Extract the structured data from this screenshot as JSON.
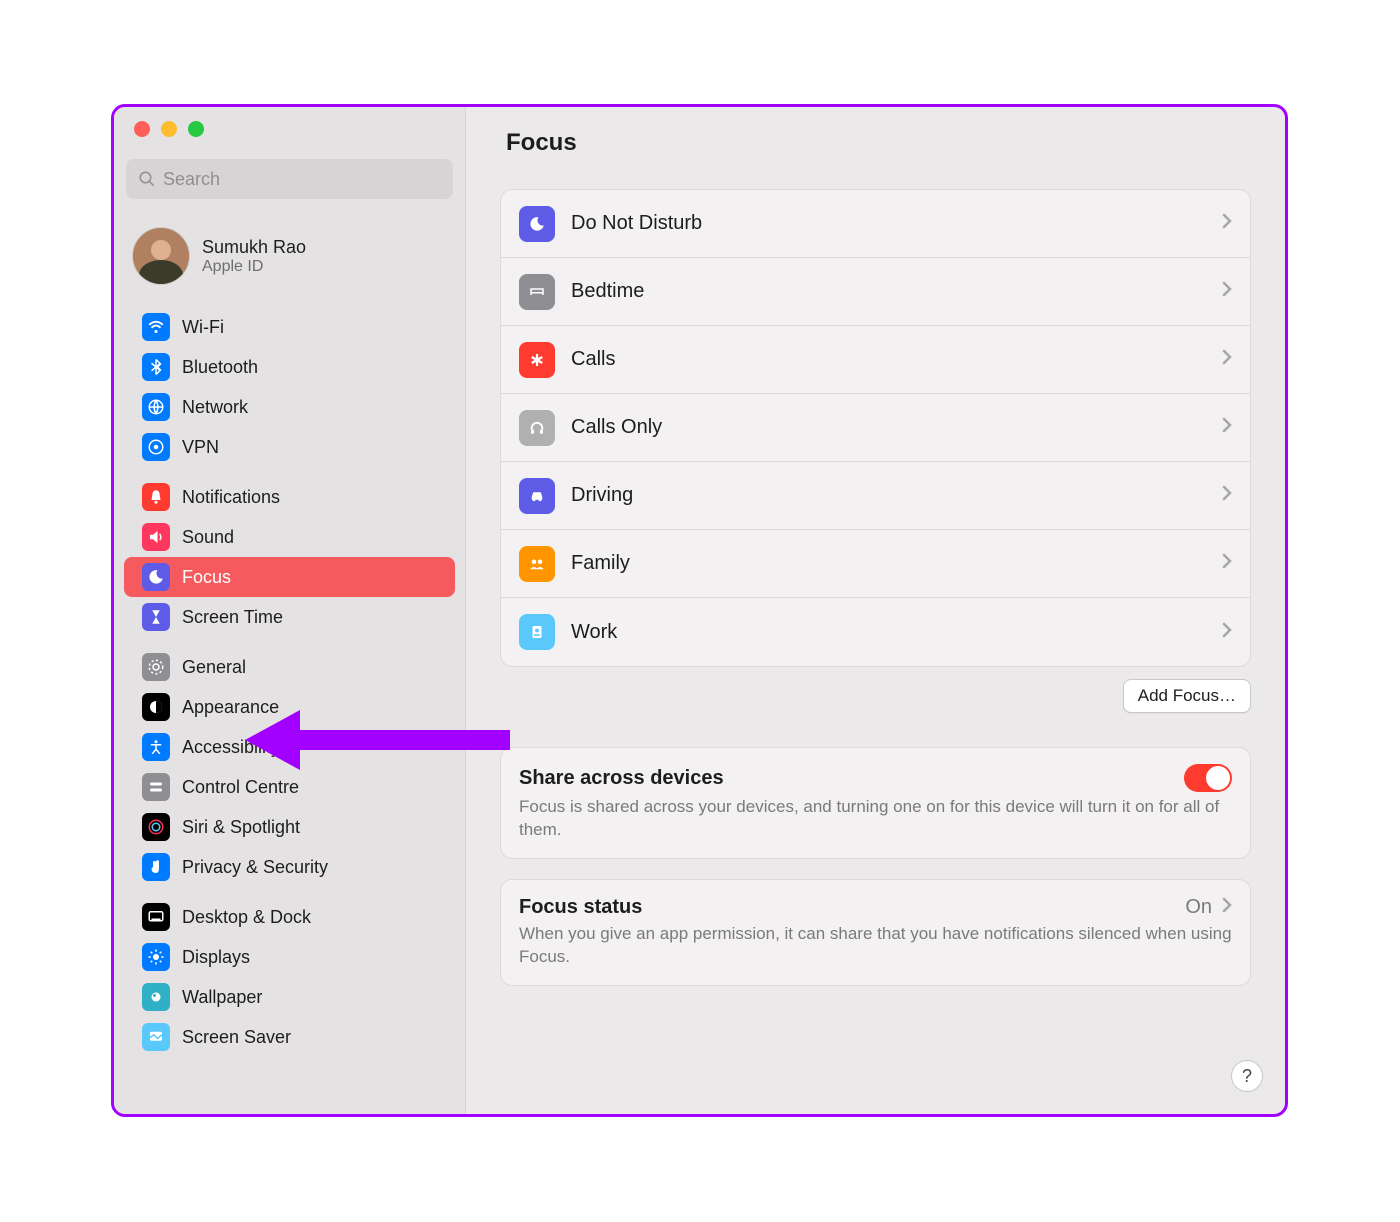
{
  "search": {
    "placeholder": "Search"
  },
  "user": {
    "name": "Sumukh Rao",
    "sub": "Apple ID"
  },
  "sidebar": {
    "g1": [
      {
        "label": "Wi-Fi",
        "icon": "wifi",
        "color": "blue"
      },
      {
        "label": "Bluetooth",
        "icon": "bluetooth",
        "color": "blue"
      },
      {
        "label": "Network",
        "icon": "network",
        "color": "blue"
      },
      {
        "label": "VPN",
        "icon": "vpn",
        "color": "blue"
      }
    ],
    "g2": [
      {
        "label": "Notifications",
        "icon": "bell",
        "color": "red"
      },
      {
        "label": "Sound",
        "icon": "sound",
        "color": "pink"
      },
      {
        "label": "Focus",
        "icon": "moon",
        "color": "indigo",
        "active": true
      },
      {
        "label": "Screen Time",
        "icon": "hourglass",
        "color": "indigo"
      }
    ],
    "g3": [
      {
        "label": "General",
        "icon": "gear",
        "color": "gray"
      },
      {
        "label": "Appearance",
        "icon": "appearance",
        "color": "black"
      },
      {
        "label": "Accessibility",
        "icon": "accessibility",
        "color": "blue"
      },
      {
        "label": "Control Centre",
        "icon": "switches",
        "color": "gray"
      },
      {
        "label": "Siri & Spotlight",
        "icon": "siri",
        "color": "black"
      },
      {
        "label": "Privacy & Security",
        "icon": "hand",
        "color": "blue"
      }
    ],
    "g4": [
      {
        "label": "Desktop & Dock",
        "icon": "dock",
        "color": "black"
      },
      {
        "label": "Displays",
        "icon": "sun",
        "color": "blue"
      },
      {
        "label": "Wallpaper",
        "icon": "wallpaper",
        "color": "teal"
      },
      {
        "label": "Screen Saver",
        "icon": "screensaver",
        "color": "cyan"
      }
    ]
  },
  "main": {
    "title": "Focus",
    "modes": [
      {
        "label": "Do Not Disturb",
        "color": "indigo",
        "icon": "moon"
      },
      {
        "label": "Bedtime",
        "color": "gray",
        "icon": "bed"
      },
      {
        "label": "Calls",
        "color": "red",
        "icon": "asterisk"
      },
      {
        "label": "Calls Only",
        "color": "lightgray",
        "icon": "headphones"
      },
      {
        "label": "Driving",
        "color": "indigo",
        "icon": "car"
      },
      {
        "label": "Family",
        "color": "orange",
        "icon": "people"
      },
      {
        "label": "Work",
        "color": "cyan",
        "icon": "badge"
      }
    ],
    "add_button": "Add Focus…",
    "share": {
      "title": "Share across devices",
      "desc": "Focus is shared across your devices, and turning one on for this device will turn it on for all of them.",
      "enabled": true
    },
    "status": {
      "title": "Focus status",
      "value": "On",
      "desc": "When you give an app permission, it can share that you have notifications silenced when using Focus."
    }
  },
  "help": "?"
}
